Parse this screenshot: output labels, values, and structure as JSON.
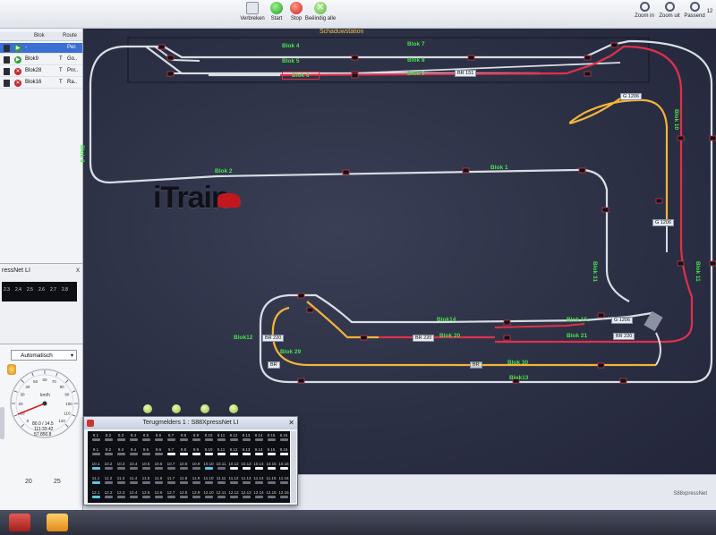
{
  "toolbar": {
    "disconnect_label": "Verbreken",
    "start_label": "Start",
    "stop_label": "Stop",
    "end_all_label": "Beëindig alle",
    "zoom_in_label": "Zoom in",
    "zoom_out_label": "Zoom uit",
    "fit_label": "Passend",
    "cut_label": "12"
  },
  "train_list": {
    "col_block": "Blok",
    "col_route": "Route",
    "rows": [
      {
        "status": "play",
        "block": "-",
        "t": "",
        "route": "Per.",
        "selected": true
      },
      {
        "status": "play",
        "block": "Blok9",
        "t": "T",
        "route": "Go..",
        "selected": false
      },
      {
        "status": "stop",
        "block": "Blok28",
        "t": "T",
        "route": "Pnr..",
        "selected": false
      },
      {
        "status": "stop",
        "block": "Blok16",
        "t": "T",
        "route": "Ra..",
        "selected": false
      }
    ]
  },
  "xpress_panel": {
    "title": "ressNet LI",
    "close": "x",
    "cells": [
      "2.3",
      "2.4",
      "2.5",
      "2.6",
      "2.7",
      "2.8"
    ]
  },
  "drive_panel": {
    "mode": "Automatisch",
    "speed_unit": "km/h",
    "readout_1": "80.0 / 14.5",
    "readout_2": "111:33:42",
    "readout_3": "57.850,8",
    "scale_left": "20",
    "scale_right": "25",
    "ticks": [
      "0",
      "10",
      "20",
      "30",
      "40",
      "50",
      "60",
      "70",
      "80",
      "90",
      "100",
      "110",
      "120"
    ]
  },
  "map": {
    "shadow_station": "Schaduwstation",
    "logo": "iTrain",
    "blocks": [
      {
        "name": "Blok 4",
        "kind": "g"
      },
      {
        "name": "Blok 5",
        "kind": "g"
      },
      {
        "name": "Blok 6",
        "kind": "g"
      },
      {
        "name": "Blok 7",
        "kind": "g"
      },
      {
        "name": "Blok 8",
        "kind": "g"
      },
      {
        "name": "Blok 9",
        "kind": "g"
      },
      {
        "name": "Blok 3",
        "kind": "g"
      },
      {
        "name": "Blok 2",
        "kind": "g"
      },
      {
        "name": "Blok 1",
        "kind": "g"
      },
      {
        "name": "Blok 10",
        "kind": "g"
      },
      {
        "name": "Blok 11",
        "kind": "g"
      },
      {
        "name": "Blok 31",
        "kind": "g"
      },
      {
        "name": "Blok14",
        "kind": "g"
      },
      {
        "name": "Blok 15",
        "kind": "g"
      },
      {
        "name": "Blok 20",
        "kind": "g"
      },
      {
        "name": "Blok 21",
        "kind": "g"
      },
      {
        "name": "Blok12",
        "kind": "g"
      },
      {
        "name": "Blok 29",
        "kind": "g"
      },
      {
        "name": "Blok 30",
        "kind": "g"
      },
      {
        "name": "Blok13",
        "kind": "g"
      }
    ],
    "trains": [
      "BR 151",
      "G 1206",
      "G 1206",
      "G 1206",
      "BR 220",
      "BR 220",
      "BR 220",
      "BR",
      "BR"
    ]
  },
  "sensor_window": {
    "title": "Terugmelders 1 : S88XpressNet LI",
    "rows": [
      [
        "8.1",
        "8.2",
        "8.3",
        "8.4",
        "8.5",
        "8.6",
        "8.7",
        "8.8",
        "8.9",
        "8.10",
        "8.11",
        "8.12",
        "8.13",
        "8.14",
        "8.15",
        "8.16"
      ],
      [
        "9.1",
        "9.2",
        "9.3",
        "9.4",
        "9.5",
        "9.6",
        "9.7",
        "9.8",
        "9.9",
        "9.10",
        "9.11",
        "9.12",
        "9.13",
        "9.14",
        "9.15",
        "9.16"
      ],
      [
        "10.1",
        "10.2",
        "10.3",
        "10.4",
        "10.5",
        "10.6",
        "10.7",
        "10.8",
        "10.9",
        "10.10",
        "10.11",
        "10.12",
        "10.13",
        "10.14",
        "10.15",
        "10.16"
      ],
      [
        "11.1",
        "11.2",
        "11.3",
        "11.4",
        "11.5",
        "11.6",
        "11.7",
        "11.8",
        "11.9",
        "11.10",
        "11.11",
        "11.12",
        "11.13",
        "11.14",
        "11.15",
        "11.16"
      ],
      [
        "12.1",
        "12.2",
        "12.3",
        "12.4",
        "12.5",
        "12.6",
        "12.7",
        "12.8",
        "12.9",
        "12.10",
        "12.11",
        "12.12",
        "12.13",
        "12.14",
        "12.15",
        "12.16"
      ]
    ]
  },
  "status": {
    "text": "S88xpressNet"
  },
  "colors": {
    "accent": "#3b6fd1",
    "track_free": "#d9dde6",
    "track_occupied": "#e0304c",
    "track_reserved": "#f4b43a",
    "label_green": "#46e24c"
  }
}
